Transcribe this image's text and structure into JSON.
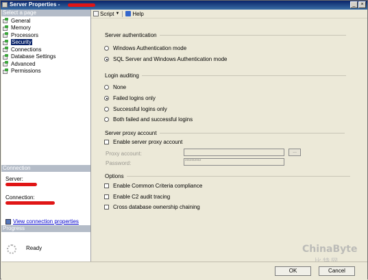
{
  "window": {
    "title": "Server Properties - ",
    "controls": {
      "minimize": "_",
      "close": "×"
    }
  },
  "left": {
    "select_page_header": "Select a page",
    "pages": [
      {
        "label": "General"
      },
      {
        "label": "Memory"
      },
      {
        "label": "Processors"
      },
      {
        "label": "Security",
        "selected": true
      },
      {
        "label": "Connections"
      },
      {
        "label": "Database Settings"
      },
      {
        "label": "Advanced"
      },
      {
        "label": "Permissions"
      }
    ],
    "connection_header": "Connection",
    "server_label": "Server:",
    "connection_label": "Connection:",
    "view_connection_properties": "View connection properties",
    "progress_header": "Progress",
    "progress_status": "Ready"
  },
  "toolbar": {
    "script": "Script",
    "help": "Help"
  },
  "server_auth": {
    "title": "Server authentication",
    "options": [
      {
        "label": "Windows Authentication mode",
        "selected": false
      },
      {
        "label": "SQL Server and Windows Authentication mode",
        "selected": true
      }
    ]
  },
  "login_auditing": {
    "title": "Login auditing",
    "options": [
      {
        "label": "None",
        "selected": false
      },
      {
        "label": "Failed logins only",
        "selected": true
      },
      {
        "label": "Successful logins only",
        "selected": false
      },
      {
        "label": "Both failed and successful logins",
        "selected": false
      }
    ]
  },
  "proxy": {
    "title": "Server proxy account",
    "enable_label": "Enable server proxy account",
    "enabled": false,
    "proxy_account_label": "Proxy account:",
    "proxy_account_value": "",
    "password_label": "Password:",
    "password_value": "**********",
    "browse_label": "..."
  },
  "options": {
    "title": "Options",
    "items": [
      {
        "label": "Enable Common Criteria compliance",
        "checked": false
      },
      {
        "label": "Enable C2 audit tracing",
        "checked": false
      },
      {
        "label": "Cross database ownership chaining",
        "checked": false
      }
    ]
  },
  "buttons": {
    "ok": "OK",
    "cancel": "Cancel"
  },
  "watermark": {
    "main": "ChinaByte",
    "sub": "比特网"
  },
  "colors": {
    "redaction": "#e01515",
    "titlebar": "#0a246a",
    "selection": "#0a246a",
    "link": "#0000cc"
  }
}
